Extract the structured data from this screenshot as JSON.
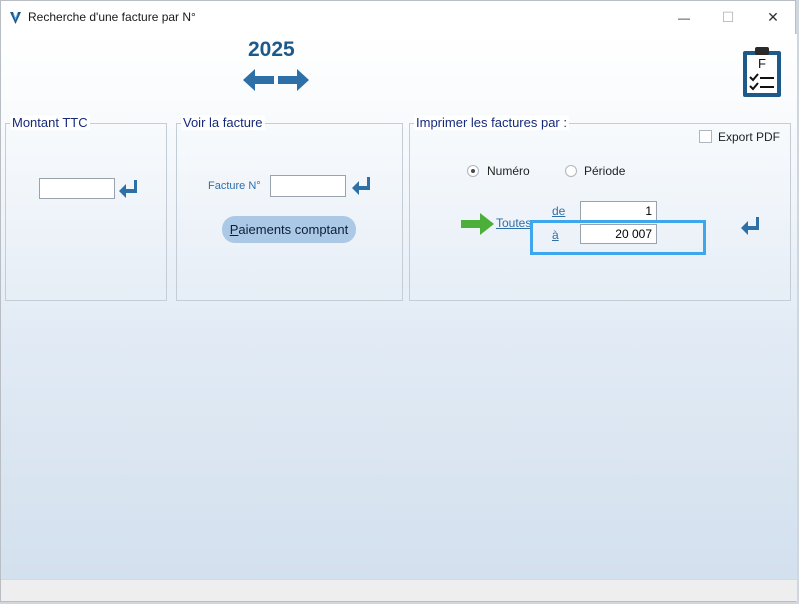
{
  "window": {
    "title": "Recherche d'une facture par N°",
    "min_glyph": "—",
    "max_glyph": "☐",
    "close_glyph": "✕"
  },
  "header": {
    "year": "2025",
    "clipboard_letter": "F"
  },
  "montant": {
    "title": "Montant TTC",
    "value": ""
  },
  "voir": {
    "title": "Voir la facture",
    "facture_label": "Facture N°",
    "facture_value": "",
    "paiements_label": "Paiements comptant"
  },
  "imprimer": {
    "title": "Imprimer les factures par :",
    "export_pdf": "Export PDF",
    "export_pdf_checked": false,
    "radio_numero": "Numéro",
    "radio_periode": "Période",
    "selected": "numero",
    "toutes": "Toutes",
    "de_label": "de",
    "de_value": "1",
    "a_label": "à",
    "a_value": "20 007"
  },
  "colors": {
    "accent": "#2f6fa8",
    "highlight": "#3da6ec",
    "arrow_green": "#4caf3a",
    "title_blue": "#162a7a"
  }
}
